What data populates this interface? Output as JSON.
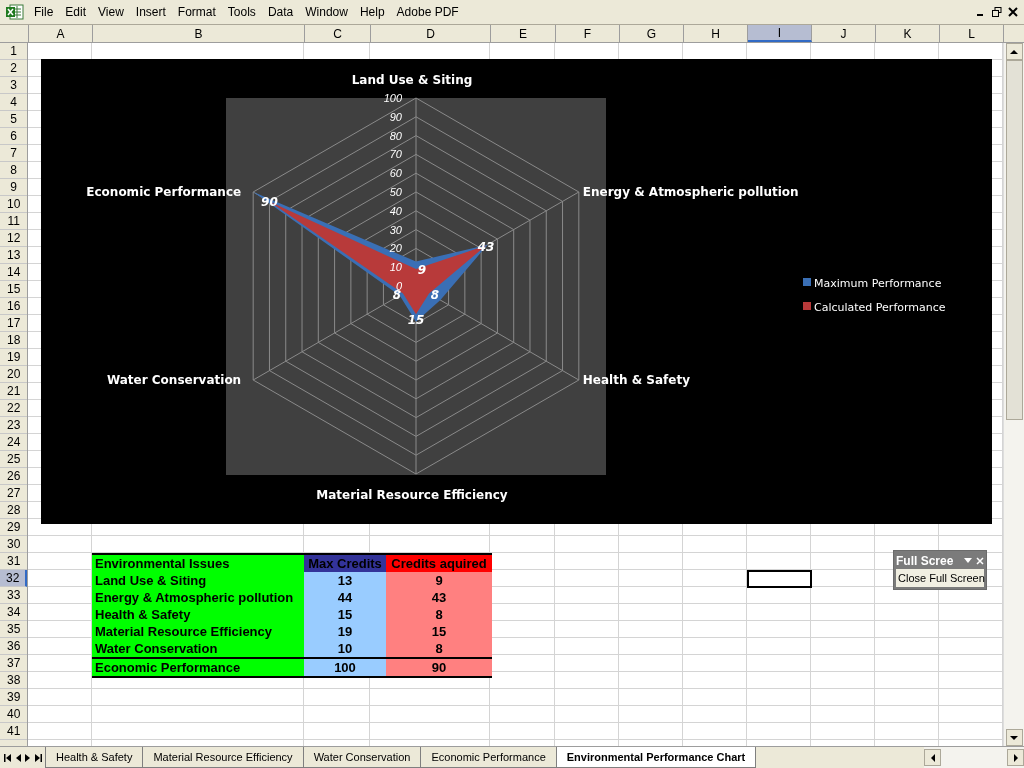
{
  "menu_bar": {
    "items": [
      "File",
      "Edit",
      "View",
      "Insert",
      "Format",
      "Tools",
      "Data",
      "Window",
      "Help",
      "Adobe PDF"
    ]
  },
  "column_headers": [
    {
      "label": "A",
      "selected": false
    },
    {
      "label": "B",
      "selected": false
    },
    {
      "label": "C",
      "selected": false
    },
    {
      "label": "D",
      "selected": false
    },
    {
      "label": "E",
      "selected": false
    },
    {
      "label": "F",
      "selected": false
    },
    {
      "label": "G",
      "selected": false
    },
    {
      "label": "H",
      "selected": false
    },
    {
      "label": "I",
      "selected": true
    },
    {
      "label": "J",
      "selected": false
    },
    {
      "label": "K",
      "selected": false
    },
    {
      "label": "L",
      "selected": false
    }
  ],
  "row_headers": [
    {
      "label": "1",
      "selected": false
    },
    {
      "label": "2",
      "selected": false
    },
    {
      "label": "3",
      "selected": false
    },
    {
      "label": "4",
      "selected": false
    },
    {
      "label": "5",
      "selected": false
    },
    {
      "label": "6",
      "selected": false
    },
    {
      "label": "7",
      "selected": false
    },
    {
      "label": "8",
      "selected": false
    },
    {
      "label": "9",
      "selected": false
    },
    {
      "label": "10",
      "selected": false
    },
    {
      "label": "11",
      "selected": false
    },
    {
      "label": "12",
      "selected": false
    },
    {
      "label": "13",
      "selected": false
    },
    {
      "label": "14",
      "selected": false
    },
    {
      "label": "15",
      "selected": false
    },
    {
      "label": "16",
      "selected": false
    },
    {
      "label": "17",
      "selected": false
    },
    {
      "label": "18",
      "selected": false
    },
    {
      "label": "19",
      "selected": false
    },
    {
      "label": "20",
      "selected": false
    },
    {
      "label": "21",
      "selected": false
    },
    {
      "label": "22",
      "selected": false
    },
    {
      "label": "23",
      "selected": false
    },
    {
      "label": "24",
      "selected": false
    },
    {
      "label": "25",
      "selected": false
    },
    {
      "label": "26",
      "selected": false
    },
    {
      "label": "27",
      "selected": false
    },
    {
      "label": "28",
      "selected": false
    },
    {
      "label": "29",
      "selected": false
    },
    {
      "label": "30",
      "selected": false
    },
    {
      "label": "31",
      "selected": false
    },
    {
      "label": "32",
      "selected": true
    },
    {
      "label": "33",
      "selected": false
    },
    {
      "label": "34",
      "selected": false
    },
    {
      "label": "35",
      "selected": false
    },
    {
      "label": "36",
      "selected": false
    },
    {
      "label": "37",
      "selected": false
    },
    {
      "label": "38",
      "selected": false
    },
    {
      "label": "39",
      "selected": false
    },
    {
      "label": "40",
      "selected": false
    },
    {
      "label": "41",
      "selected": false
    }
  ],
  "chart": {
    "category_labels": [
      "Land Use & Siting",
      "Economic Performance",
      "Energy & Atmospheric pollution",
      "Water Conservation",
      "Health & Safety",
      "Material Resource Efficiency"
    ],
    "tick_labels": [
      "100",
      "90",
      "80",
      "70",
      "60",
      "50",
      "40",
      "30",
      "20",
      "10",
      "0"
    ],
    "data_labels": [
      "9",
      "43",
      "8",
      "15",
      "8",
      "90"
    ],
    "legend": [
      {
        "name": "Maximum Performance",
        "color": "#3a6fb5"
      },
      {
        "name": "Calculated Performance",
        "color": "#b83a3a"
      }
    ]
  },
  "table": {
    "columns": [
      "Environmental Issues",
      "Max Credits",
      "Credits aquired"
    ],
    "rows": [
      {
        "kind": "item",
        "cells": [
          "Land Use & Siting",
          "13",
          "9"
        ]
      },
      {
        "kind": "item",
        "cells": [
          "Energy & Atmospheric pollution",
          "44",
          "43"
        ]
      },
      {
        "kind": "item",
        "cells": [
          "Health & Safety",
          "15",
          "8"
        ]
      },
      {
        "kind": "item",
        "cells": [
          "Material Resource Efficiency",
          "19",
          "15"
        ]
      },
      {
        "kind": "item",
        "cells": [
          "Water Conservation",
          "10",
          "8"
        ]
      },
      {
        "kind": "total",
        "cells": [
          "Economic Performance",
          "100",
          "90"
        ]
      }
    ]
  },
  "floating_toolbar": {
    "title": "Full Scree",
    "button": "Close Full Screen"
  },
  "sheet_tabs": [
    {
      "label": "Health & Safety",
      "selected": false
    },
    {
      "label": "Material Resource Efficiency",
      "selected": false
    },
    {
      "label": "Water Conservation",
      "selected": false
    },
    {
      "label": "Economic Performance",
      "selected": false
    },
    {
      "label": "Environmental Performance Chart",
      "selected": true
    }
  ]
}
